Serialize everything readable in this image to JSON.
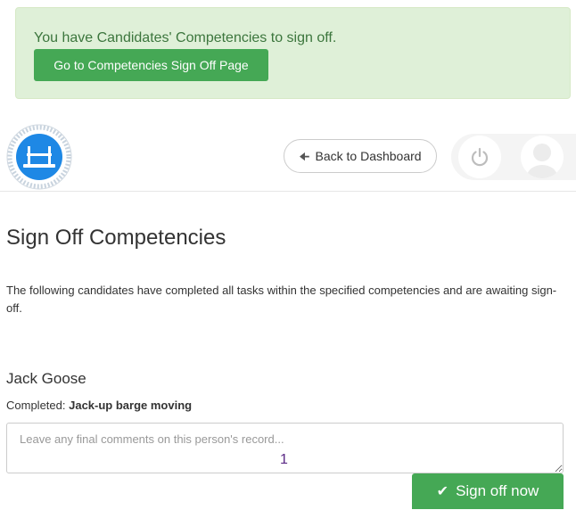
{
  "alert": {
    "message": "You have Candidates' Competencies to sign off.",
    "button_label": "Go to Competencies Sign Off Page"
  },
  "header": {
    "back_label": "Back to Dashboard",
    "back_icon": "arrow-left-icon",
    "power_icon": "power-icon",
    "avatar_icon": "user-avatar-icon"
  },
  "page": {
    "title": "Sign Off Competencies",
    "intro": "The following candidates have completed all tasks within the specified competencies and are awaiting sign-off."
  },
  "candidate": {
    "name": "Jack Goose",
    "completed_label": "Completed:",
    "competency": "Jack-up barge moving",
    "comment_placeholder": "Leave any final comments on this person's record...",
    "annotation_marker": "1",
    "signoff_label": "Sign off now",
    "signoff_icon": "check-icon"
  },
  "colors": {
    "alert_bg": "#dff0d8",
    "alert_text": "#3c763d",
    "primary_green": "#45a855",
    "logo_blue": "#1e88e5",
    "marker": "#5b2a86"
  }
}
